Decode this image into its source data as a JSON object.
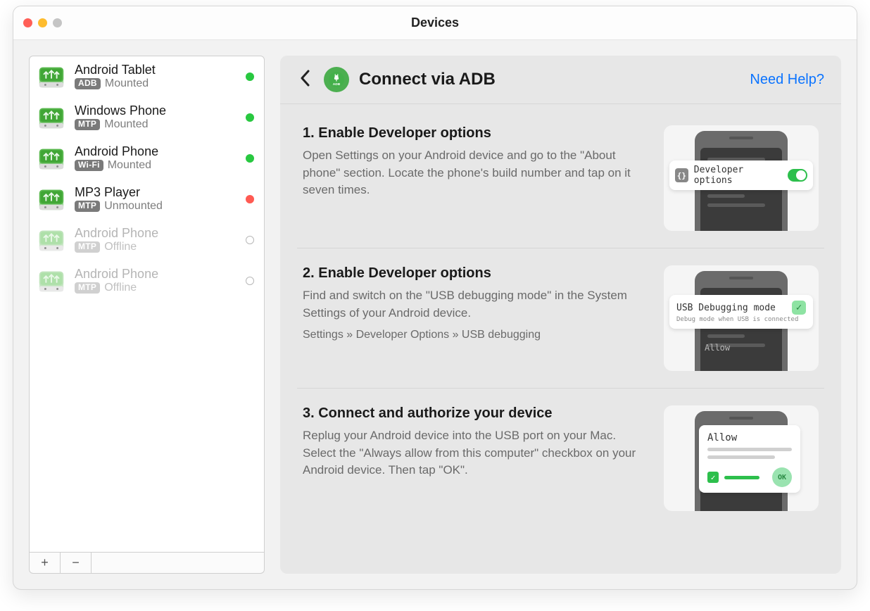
{
  "window": {
    "title": "Devices"
  },
  "sidebar": {
    "devices": [
      {
        "name": "Android Tablet",
        "badge": "ADB",
        "state": "Mounted",
        "status": "green",
        "dim": false
      },
      {
        "name": "Windows Phone",
        "badge": "MTP",
        "state": "Mounted",
        "status": "green",
        "dim": false
      },
      {
        "name": "Android Phone",
        "badge": "Wi-Fi",
        "state": "Mounted",
        "status": "green",
        "dim": false
      },
      {
        "name": "MP3 Player",
        "badge": "MTP",
        "state": "Unmounted",
        "status": "red",
        "dim": false
      },
      {
        "name": "Android Phone",
        "badge": "MTP",
        "state": "Offline",
        "status": "empty",
        "dim": true
      },
      {
        "name": "Android Phone",
        "badge": "MTP",
        "state": "Offline",
        "status": "empty",
        "dim": true
      }
    ],
    "buttons": {
      "add": "+",
      "remove": "−"
    }
  },
  "main": {
    "badge_text": "ADB",
    "title": "Connect via ADB",
    "help": "Need Help?",
    "steps": [
      {
        "title": "1. Enable Developer options",
        "desc": "Open Settings on your Android device and go to the \"About phone\" section. Locate the phone's build number and tap on it seven times.",
        "illus": {
          "type": "dev_options",
          "label": "Developer options"
        }
      },
      {
        "title": "2. Enable Developer options",
        "desc": "Find and switch on the \"USB debugging mode\" in the System Settings of your Android device.",
        "path": "Settings » Developer Options » USB debugging",
        "illus": {
          "type": "usb_debug",
          "label": "USB Debugging mode",
          "sub": "Debug mode when USB is connected",
          "allow": "Allow"
        }
      },
      {
        "title": "3. Connect and authorize your device",
        "desc": "Replug your Android device into the USB port on your Mac. Select the \"Always allow from this computer\" checkbox on your Android device. Then tap \"OK\".",
        "illus": {
          "type": "authorize",
          "title": "Allow",
          "ok": "OK"
        }
      }
    ]
  },
  "colors": {
    "accent": "#2dbf4c",
    "link": "#0a73ff"
  }
}
